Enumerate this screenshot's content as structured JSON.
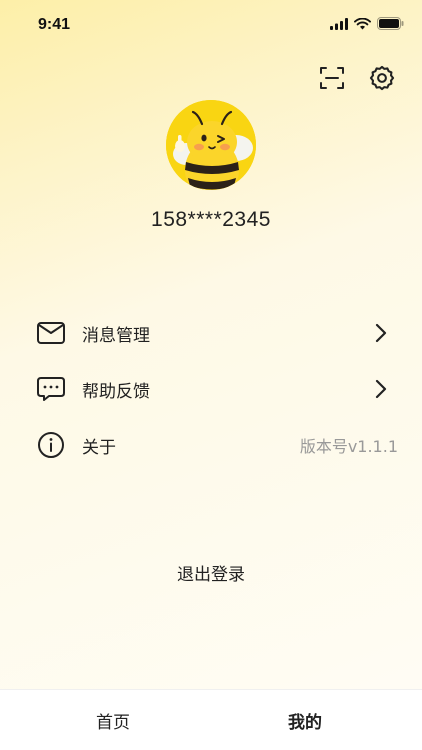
{
  "status_bar": {
    "time": "9:41"
  },
  "header": {
    "icons": [
      "scan-icon",
      "settings-gear-icon"
    ]
  },
  "profile": {
    "phone": "158****2345",
    "avatar": "bee-mascot-avatar"
  },
  "menu": [
    {
      "icon": "mail-icon",
      "label": "消息管理",
      "trailing": "chevron-right-icon"
    },
    {
      "icon": "chat-bubble-icon",
      "label": "帮助反馈",
      "trailing": "chevron-right-icon"
    },
    {
      "icon": "info-icon",
      "label": "关于",
      "value": "版本号v1.1.1"
    }
  ],
  "logout": {
    "label": "退出登录"
  },
  "tabbar": {
    "tabs": [
      {
        "label": "首页",
        "active": false
      },
      {
        "label": "我的",
        "active": true
      }
    ]
  },
  "colors": {
    "accent": "#f7d63a",
    "text": "#222222",
    "muted": "#999999"
  }
}
